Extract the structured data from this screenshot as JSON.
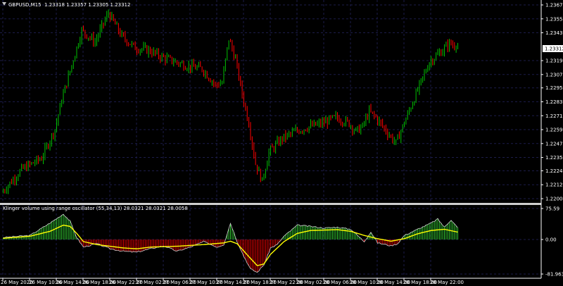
{
  "main_panel": {
    "symbol_label": "GBPUSD,M15",
    "ohlc_label": "1.23318 1.23357 1.23305 1.23312",
    "price_ticks": [
      "1.23670",
      "1.23550",
      "1.23430",
      "1.23312",
      "1.23190",
      "1.23070",
      "1.22955",
      "1.22835",
      "1.22715",
      "1.22595",
      "1.22475",
      "1.22355",
      "1.22240",
      "1.22120",
      "1.22000"
    ],
    "current_price_label": "1.23312"
  },
  "indicator_panel": {
    "title": "Klinger volume using range oscillator (55,34,13) 28.0321 28.0321 28.0058",
    "ticks": [
      "75.59",
      "0.00",
      "-81.963"
    ]
  },
  "time_axis": {
    "labels": [
      "26 May 2020",
      "26 May 10:00",
      "26 May 14:00",
      "26 May 18:00",
      "26 May 22:00",
      "27 May 02:00",
      "27 May 06:00",
      "27 May 10:00",
      "27 May 14:00",
      "27 May 18:00",
      "27 May 22:00",
      "28 May 02:00",
      "28 May 06:00",
      "28 May 10:00",
      "28 May 14:00",
      "28 May 18:00",
      "28 May 22:00"
    ]
  },
  "colors": {
    "background": "#000000",
    "bull": "#00c000",
    "bear": "#ff0000",
    "grid": "#1c1c4a",
    "osc_positive": "#33cc33",
    "osc_negative": "#e60000",
    "signal_line": "#ffff00",
    "current_price_box": "#ffffff"
  },
  "chart_data": [
    {
      "type": "candlestick",
      "symbol": "GBPUSD",
      "timeframe": "M15",
      "ylim": [
        1.22,
        1.2367
      ],
      "close_path": [
        {
          "t": "26 May 2020 00:00",
          "price": 1.2205
        },
        {
          "t": "26 May 03:00",
          "price": 1.2225
        },
        {
          "t": "26 May 06:00",
          "price": 1.2235
        },
        {
          "t": "26 May 08:00",
          "price": 1.226
        },
        {
          "t": "26 May 09:00",
          "price": 1.2285
        },
        {
          "t": "26 May 10:00",
          "price": 1.2305
        },
        {
          "t": "26 May 11:00",
          "price": 1.2325
        },
        {
          "t": "26 May 12:00",
          "price": 1.2345
        },
        {
          "t": "26 May 14:00",
          "price": 1.2335
        },
        {
          "t": "26 May 15:00",
          "price": 1.2348
        },
        {
          "t": "26 May 16:00",
          "price": 1.236
        },
        {
          "t": "26 May 18:00",
          "price": 1.234
        },
        {
          "t": "26 May 20:00",
          "price": 1.233
        },
        {
          "t": "26 May 22:00",
          "price": 1.2328
        },
        {
          "t": "27 May 00:00",
          "price": 1.2322
        },
        {
          "t": "27 May 02:00",
          "price": 1.2318
        },
        {
          "t": "27 May 04:00",
          "price": 1.2314
        },
        {
          "t": "27 May 06:00",
          "price": 1.2312
        },
        {
          "t": "27 May 08:00",
          "price": 1.2298
        },
        {
          "t": "27 May 09:00",
          "price": 1.23
        },
        {
          "t": "27 May 10:00",
          "price": 1.2338
        },
        {
          "t": "27 May 11:00",
          "price": 1.232
        },
        {
          "t": "27 May 12:00",
          "price": 1.229
        },
        {
          "t": "27 May 13:00",
          "price": 1.2265
        },
        {
          "t": "27 May 14:00",
          "price": 1.223
        },
        {
          "t": "27 May 15:00",
          "price": 1.2215
        },
        {
          "t": "27 May 16:00",
          "price": 1.224
        },
        {
          "t": "27 May 18:00",
          "price": 1.2252
        },
        {
          "t": "27 May 20:00",
          "price": 1.2258
        },
        {
          "t": "27 May 22:00",
          "price": 1.2262
        },
        {
          "t": "28 May 00:00",
          "price": 1.2265
        },
        {
          "t": "28 May 02:00",
          "price": 1.227
        },
        {
          "t": "28 May 04:00",
          "price": 1.2265
        },
        {
          "t": "28 May 05:00",
          "price": 1.2258
        },
        {
          "t": "28 May 06:00",
          "price": 1.2262
        },
        {
          "t": "28 May 07:00",
          "price": 1.2275
        },
        {
          "t": "28 May 08:00",
          "price": 1.227
        },
        {
          "t": "28 May 10:00",
          "price": 1.2255
        },
        {
          "t": "28 May 11:00",
          "price": 1.2248
        },
        {
          "t": "28 May 12:00",
          "price": 1.2262
        },
        {
          "t": "28 May 14:00",
          "price": 1.229
        },
        {
          "t": "28 May 16:00",
          "price": 1.2318
        },
        {
          "t": "28 May 17:00",
          "price": 1.2323
        },
        {
          "t": "28 May 18:00",
          "price": 1.2328
        },
        {
          "t": "28 May 19:00",
          "price": 1.2334
        },
        {
          "t": "28 May 20:00",
          "price": 1.2331
        }
      ]
    },
    {
      "type": "histogram+line",
      "name": "Klinger volume using range oscillator (55,34,13)",
      "ylim": [
        -81.963,
        75.59
      ],
      "histogram": [
        {
          "t": "26 May 2020 00:00",
          "v": 5
        },
        {
          "t": "26 May 04:00",
          "v": 10
        },
        {
          "t": "26 May 07:00",
          "v": 40
        },
        {
          "t": "26 May 09:00",
          "v": 62
        },
        {
          "t": "26 May 10:00",
          "v": 45
        },
        {
          "t": "26 May 11:00",
          "v": 5
        },
        {
          "t": "26 May 12:00",
          "v": -18
        },
        {
          "t": "26 May 14:00",
          "v": -10
        },
        {
          "t": "26 May 16:00",
          "v": -22
        },
        {
          "t": "26 May 18:00",
          "v": -28
        },
        {
          "t": "26 May 20:00",
          "v": -30
        },
        {
          "t": "26 May 22:00",
          "v": -22
        },
        {
          "t": "27 May 00:00",
          "v": -15
        },
        {
          "t": "27 May 02:00",
          "v": -28
        },
        {
          "t": "27 May 04:00",
          "v": -18
        },
        {
          "t": "27 May 06:00",
          "v": -5
        },
        {
          "t": "27 May 08:00",
          "v": -18
        },
        {
          "t": "27 May 09:00",
          "v": -12
        },
        {
          "t": "27 May 10:00",
          "v": 40
        },
        {
          "t": "27 May 11:00",
          "v": -5
        },
        {
          "t": "27 May 12:00",
          "v": -40
        },
        {
          "t": "27 May 13:00",
          "v": -70
        },
        {
          "t": "27 May 14:00",
          "v": -78
        },
        {
          "t": "27 May 15:00",
          "v": -60
        },
        {
          "t": "27 May 16:00",
          "v": -20
        },
        {
          "t": "27 May 17:00",
          "v": -12
        },
        {
          "t": "27 May 18:00",
          "v": 8
        },
        {
          "t": "27 May 20:00",
          "v": 35
        },
        {
          "t": "27 May 22:00",
          "v": 32
        },
        {
          "t": "28 May 00:00",
          "v": 28
        },
        {
          "t": "28 May 02:00",
          "v": 30
        },
        {
          "t": "28 May 04:00",
          "v": 25
        },
        {
          "t": "28 May 05:00",
          "v": 10
        },
        {
          "t": "28 May 06:00",
          "v": -5
        },
        {
          "t": "28 May 07:00",
          "v": 18
        },
        {
          "t": "28 May 08:00",
          "v": -8
        },
        {
          "t": "28 May 10:00",
          "v": -15
        },
        {
          "t": "28 May 11:00",
          "v": -10
        },
        {
          "t": "28 May 12:00",
          "v": 10
        },
        {
          "t": "28 May 14:00",
          "v": 25
        },
        {
          "t": "28 May 16:00",
          "v": 40
        },
        {
          "t": "28 May 17:00",
          "v": 50
        },
        {
          "t": "28 May 18:00",
          "v": 30
        },
        {
          "t": "28 May 19:00",
          "v": 48
        },
        {
          "t": "28 May 20:00",
          "v": 28
        }
      ],
      "signal": [
        {
          "t": "26 May 2020 00:00",
          "v": 3
        },
        {
          "t": "26 May 04:00",
          "v": 8
        },
        {
          "t": "26 May 07:00",
          "v": 20
        },
        {
          "t": "26 May 09:00",
          "v": 35
        },
        {
          "t": "26 May 10:00",
          "v": 32
        },
        {
          "t": "26 May 11:00",
          "v": 15
        },
        {
          "t": "26 May 12:00",
          "v": -5
        },
        {
          "t": "26 May 14:00",
          "v": -12
        },
        {
          "t": "26 May 18:00",
          "v": -20
        },
        {
          "t": "26 May 20:00",
          "v": -22
        },
        {
          "t": "26 May 22:00",
          "v": -18
        },
        {
          "t": "27 May 02:00",
          "v": -16
        },
        {
          "t": "27 May 06:00",
          "v": -12
        },
        {
          "t": "27 May 09:00",
          "v": -8
        },
        {
          "t": "27 May 10:00",
          "v": -4
        },
        {
          "t": "27 May 11:00",
          "v": -10
        },
        {
          "t": "27 May 13:00",
          "v": -45
        },
        {
          "t": "27 May 14:00",
          "v": -62
        },
        {
          "t": "27 May 15:00",
          "v": -58
        },
        {
          "t": "27 May 16:00",
          "v": -35
        },
        {
          "t": "27 May 18:00",
          "v": -5
        },
        {
          "t": "27 May 20:00",
          "v": 15
        },
        {
          "t": "27 May 22:00",
          "v": 22
        },
        {
          "t": "28 May 02:00",
          "v": 24
        },
        {
          "t": "28 May 04:00",
          "v": 20
        },
        {
          "t": "28 May 06:00",
          "v": 10
        },
        {
          "t": "28 May 08:00",
          "v": 2
        },
        {
          "t": "28 May 10:00",
          "v": -4
        },
        {
          "t": "28 May 12:00",
          "v": 2
        },
        {
          "t": "28 May 14:00",
          "v": 14
        },
        {
          "t": "28 May 16:00",
          "v": 22
        },
        {
          "t": "28 May 18:00",
          "v": 25
        },
        {
          "t": "28 May 20:00",
          "v": 18
        }
      ]
    }
  ]
}
